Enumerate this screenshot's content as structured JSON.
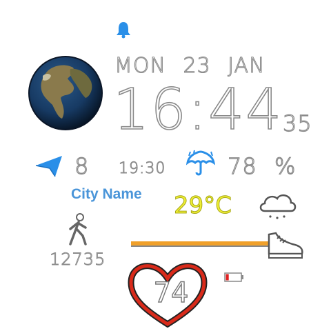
{
  "date": {
    "weekday": "MON",
    "day": "23",
    "month": "JAN"
  },
  "time": {
    "hm": "16:44",
    "seconds": "35"
  },
  "navigation": {
    "value": "8",
    "icon": "navigation-arrow-icon"
  },
  "sunset": {
    "time": "19:30"
  },
  "humidity": {
    "value": "78",
    "unit": "%",
    "icon": "umbrella-icon"
  },
  "location": {
    "city": "City Name"
  },
  "weather": {
    "temperature": "29°C",
    "icon": "cloud-rain-icon"
  },
  "steps": {
    "count": "12735",
    "icon": "walking-person-icon",
    "goal_progress": 1.0
  },
  "heart": {
    "rate": "74",
    "icon": "heart-icon"
  },
  "battery": {
    "level": 0.2,
    "icon": "battery-icon"
  },
  "colors": {
    "accent_blue": "#2a8fe8",
    "city_blue": "#4a95d9",
    "temperature_yellow": "#eeee33",
    "progress_orange": "#f0a02a",
    "heart_red": "#d92a1a",
    "battery_red": "#e02020"
  }
}
